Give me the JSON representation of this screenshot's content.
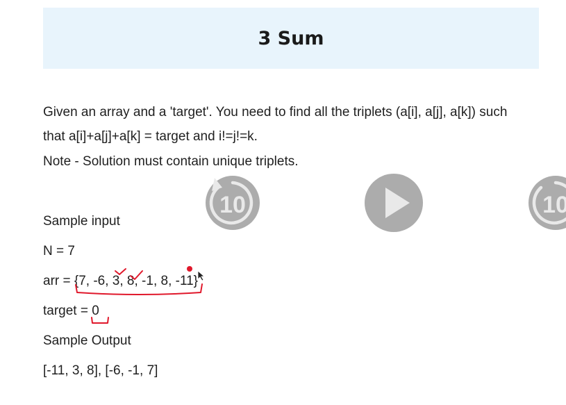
{
  "title": "3 Sum",
  "problem": {
    "line1": "Given an array and a 'target'. You need to find all the triplets (a[i], a[j], a[k]) such",
    "line2": "that a[i]+a[j]+a[k] = target and i!=j!=k.",
    "line3": "Note - Solution must contain unique triplets."
  },
  "sample": {
    "input_label": "Sample input",
    "n_line": "N = 7",
    "arr_line": "arr = {7, -6, 3, 8, -1, 8, -11}",
    "target_line": "target = 0",
    "output_label": "Sample Output",
    "output_line": "[-11, 3, 8], [-6, -1, 7]"
  },
  "player_controls": {
    "rewind_label": "10",
    "forward_label": "10",
    "control_color": "#9e9e9e"
  },
  "annotation_color": "#e0182b"
}
